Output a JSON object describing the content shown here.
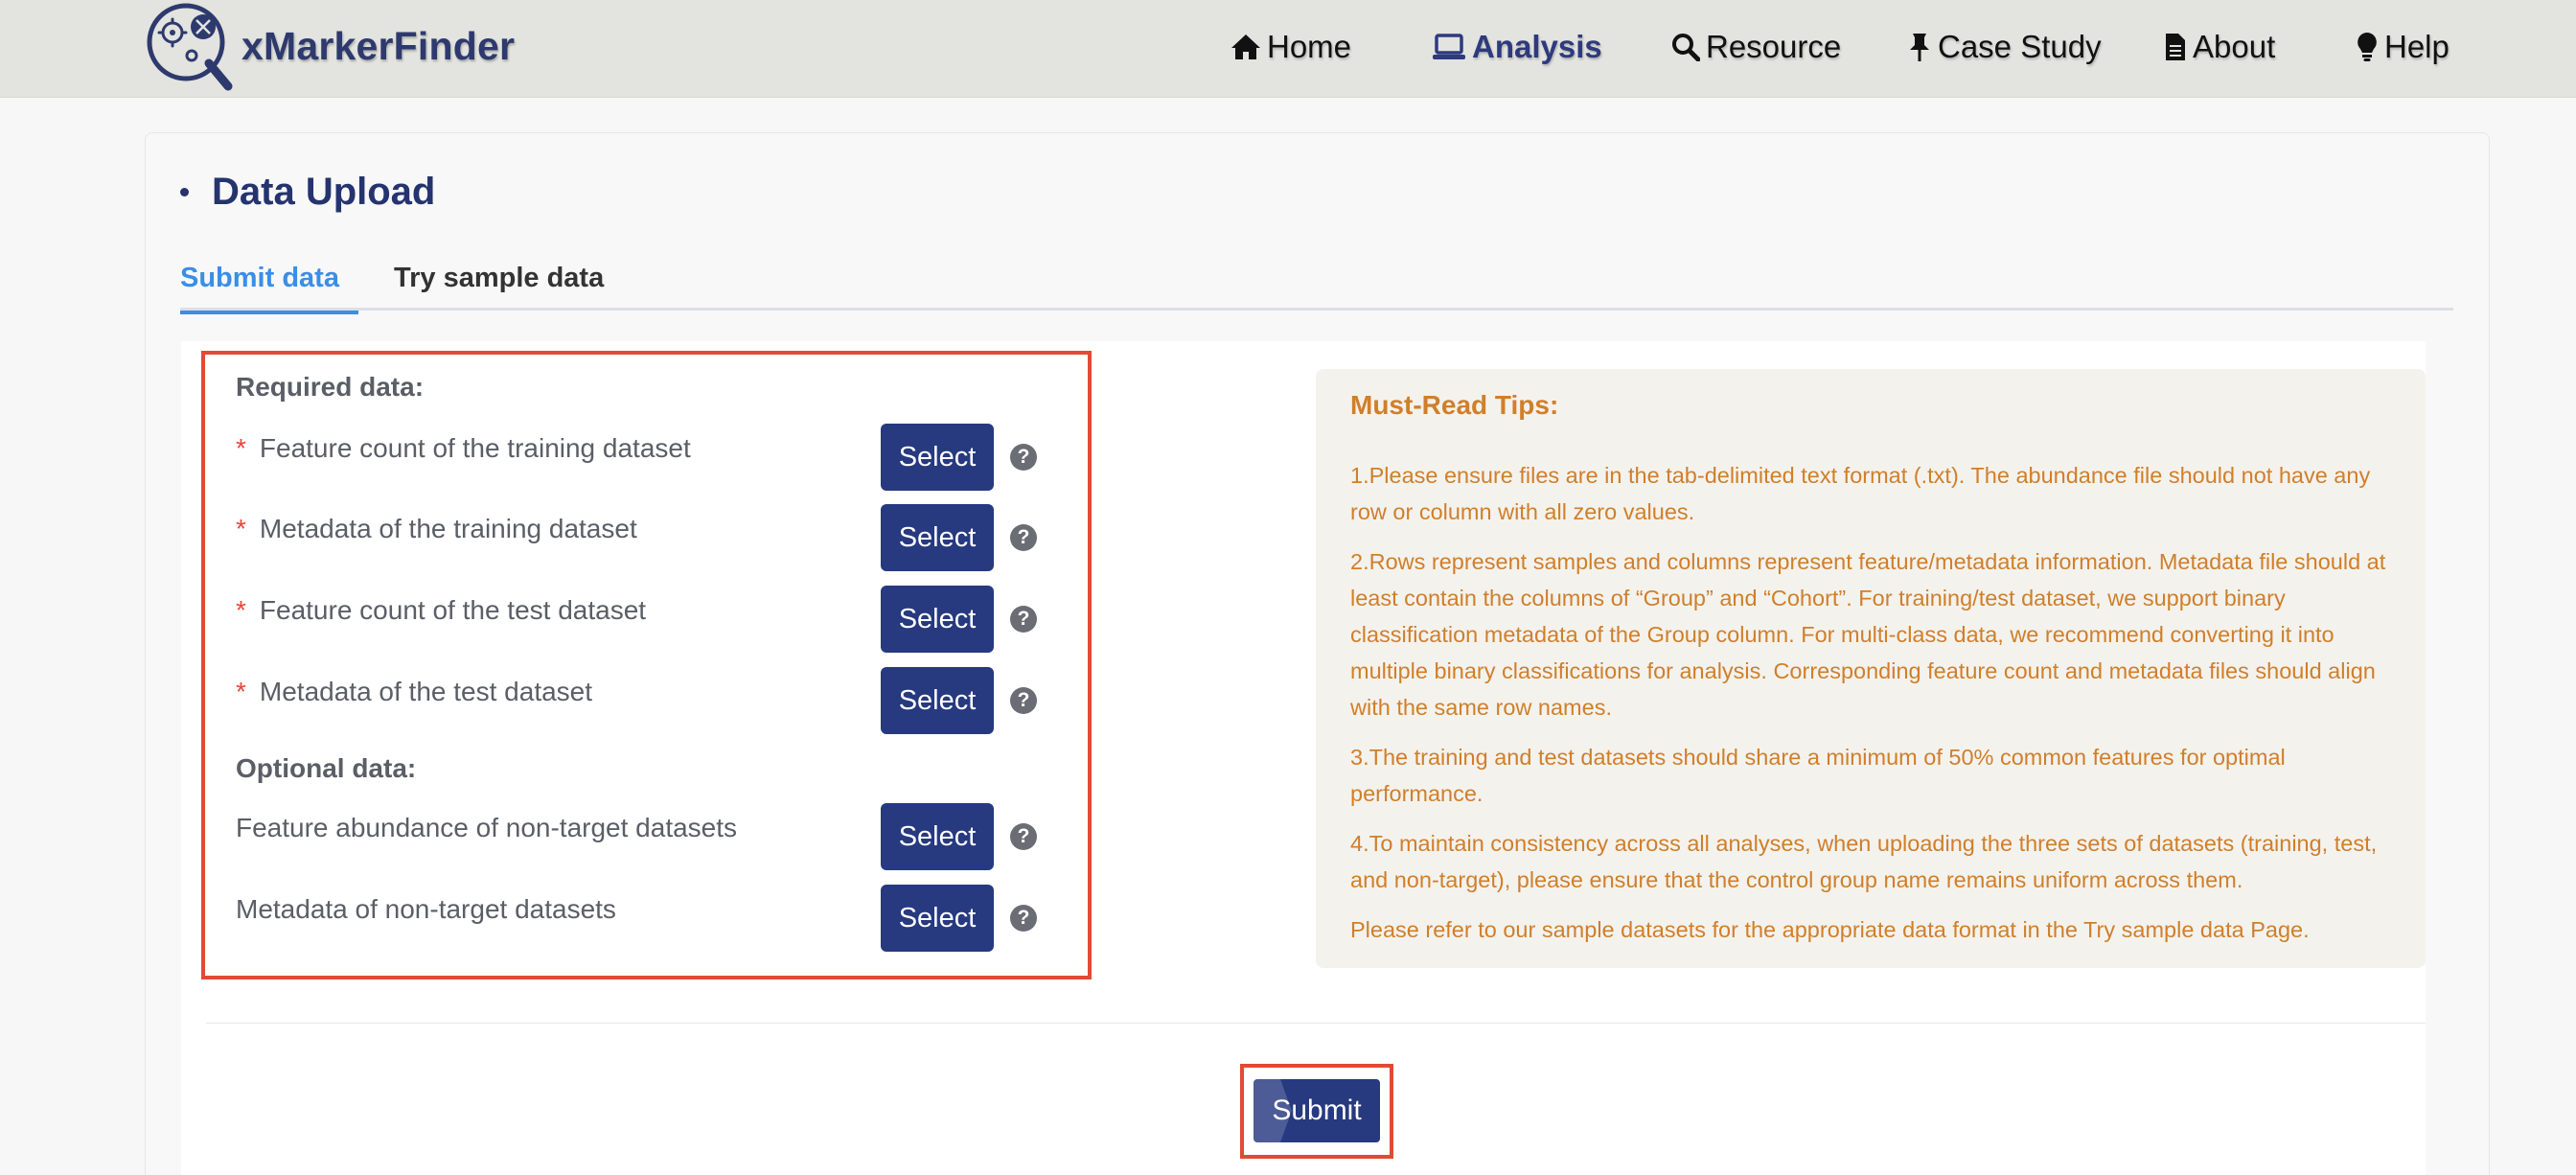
{
  "brand": {
    "name": "xMarkerFinder"
  },
  "nav": {
    "items": [
      {
        "label": "Home",
        "icon": "home-icon"
      },
      {
        "label": "Analysis",
        "icon": "laptop-icon",
        "active": true
      },
      {
        "label": "Resource",
        "icon": "search-icon"
      },
      {
        "label": "Case Study",
        "icon": "pushpin-icon"
      },
      {
        "label": "About",
        "icon": "document-icon"
      },
      {
        "label": "Help",
        "icon": "lightbulb-icon"
      }
    ]
  },
  "section": {
    "title": "Data Upload"
  },
  "tabs": [
    {
      "label": "Submit data",
      "active": true
    },
    {
      "label": "Try sample data",
      "active": false
    }
  ],
  "upload": {
    "required_heading": "Required data:",
    "optional_heading": "Optional data:",
    "required_marker": "*",
    "select_label": "Select",
    "help_glyph": "?",
    "required_items": [
      {
        "label": "Feature count of the training dataset"
      },
      {
        "label": "Metadata of the training dataset"
      },
      {
        "label": "Feature count of the test dataset"
      },
      {
        "label": "Metadata of the test dataset"
      }
    ],
    "optional_items": [
      {
        "label": "Feature abundance of non-target datasets"
      },
      {
        "label": "Metadata of non-target datasets"
      }
    ]
  },
  "tips": {
    "title": "Must-Read Tips:",
    "items": [
      "1.Please ensure files are in the tab-delimited text format (.txt). The abundance file should not have any row or column with all zero values.",
      "2.Rows represent samples and columns represent feature/metadata information. Metadata file should at least contain the columns of “Group” and “Cohort”. For training/test dataset, we support binary classification metadata of the Group column. For multi-class data, we recommend converting it into multiple binary classifications for analysis. Corresponding feature count and metadata files should align with the same row names.",
      "3.The training and test datasets should share a minimum of 50% common features for optimal performance.",
      "4.To maintain consistency across all analyses, when uploading the three sets of datasets (training, test, and non-target), please ensure that the control group name remains uniform across them.",
      "Please refer to our sample datasets for the appropriate data format in the Try sample data Page."
    ]
  },
  "submit": {
    "label": "Submit"
  },
  "colors": {
    "primary": "#27397f",
    "tab_active": "#3a8ee6",
    "highlight": "#e24a35",
    "tips_text": "#d07f2a",
    "tips_bg": "#f4f2ed"
  }
}
